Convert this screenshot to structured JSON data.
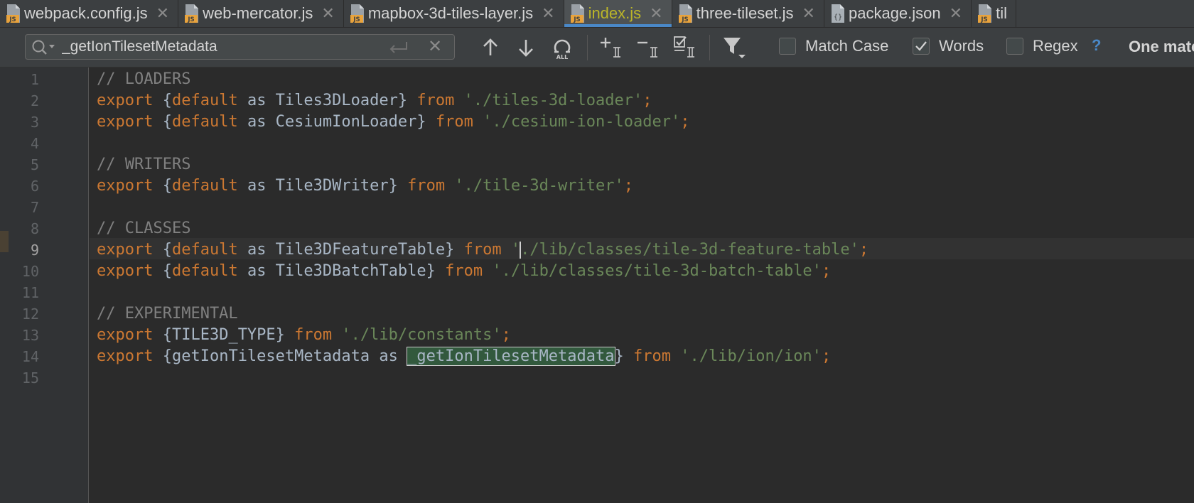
{
  "tabs": [
    {
      "label": "webpack.config.js",
      "icon": "js-file-icon",
      "active": false
    },
    {
      "label": "web-mercator.js",
      "icon": "js-file-icon",
      "active": false
    },
    {
      "label": "mapbox-3d-tiles-layer.js",
      "icon": "js-file-icon",
      "active": false
    },
    {
      "label": "index.js",
      "icon": "js-file-icon",
      "active": true
    },
    {
      "label": "three-tileset.js",
      "icon": "js-file-icon",
      "active": false
    },
    {
      "label": "package.json",
      "icon": "json-file-icon",
      "active": false
    },
    {
      "label": "til",
      "icon": "js-file-icon",
      "active": false
    }
  ],
  "tab_icon_text": "JS",
  "find": {
    "query": "_getIonTilesetMetadata",
    "match_case_label": "Match Case",
    "match_case_checked": false,
    "words_label": "Words",
    "words_checked": true,
    "regex_label": "Regex",
    "regex_checked": false,
    "help_label": "?",
    "result_text": "One match"
  },
  "editor": {
    "line_numbers": [
      "1",
      "2",
      "3",
      "4",
      "5",
      "6",
      "7",
      "8",
      "9",
      "10",
      "11",
      "12",
      "13",
      "14",
      "15"
    ],
    "current_line": "9",
    "lines": [
      [
        {
          "t": "// LOADERS",
          "c": "cm"
        }
      ],
      [
        {
          "t": "export",
          "c": "kw"
        },
        {
          "t": " {"
        },
        {
          "t": "default",
          "c": "kw"
        },
        {
          "t": " as Tiles3DLoader} "
        },
        {
          "t": "from",
          "c": "kw"
        },
        {
          "t": " "
        },
        {
          "t": "'./tiles-3d-loader'",
          "c": "str"
        },
        {
          "t": ";",
          "c": "kw"
        }
      ],
      [
        {
          "t": "export",
          "c": "kw"
        },
        {
          "t": " {"
        },
        {
          "t": "default",
          "c": "kw"
        },
        {
          "t": " as CesiumIonLoader} "
        },
        {
          "t": "from",
          "c": "kw"
        },
        {
          "t": " "
        },
        {
          "t": "'./cesium-ion-loader'",
          "c": "str"
        },
        {
          "t": ";",
          "c": "kw"
        }
      ],
      [],
      [
        {
          "t": "// WRITERS",
          "c": "cm"
        }
      ],
      [
        {
          "t": "export",
          "c": "kw"
        },
        {
          "t": " {"
        },
        {
          "t": "default",
          "c": "kw"
        },
        {
          "t": " as Tile3DWriter} "
        },
        {
          "t": "from",
          "c": "kw"
        },
        {
          "t": " "
        },
        {
          "t": "'./tile-3d-writer'",
          "c": "str"
        },
        {
          "t": ";",
          "c": "kw"
        }
      ],
      [],
      [
        {
          "t": "// CLASSES",
          "c": "cm"
        }
      ],
      [
        {
          "t": "export",
          "c": "kw"
        },
        {
          "t": " {"
        },
        {
          "t": "default",
          "c": "kw"
        },
        {
          "t": " as Tile3DFeatureTable} "
        },
        {
          "t": "from",
          "c": "kw"
        },
        {
          "t": " "
        },
        {
          "t": "'",
          "c": "str"
        },
        {
          "caret": true
        },
        {
          "t": "./lib/classes/tile-3d-feature-table'",
          "c": "str"
        },
        {
          "t": ";",
          "c": "kw"
        }
      ],
      [
        {
          "t": "export",
          "c": "kw"
        },
        {
          "t": " {"
        },
        {
          "t": "default",
          "c": "kw"
        },
        {
          "t": " as Tile3DBatchTable} "
        },
        {
          "t": "from",
          "c": "kw"
        },
        {
          "t": " "
        },
        {
          "t": "'./lib/classes/tile-3d-batch-table'",
          "c": "str"
        },
        {
          "t": ";",
          "c": "kw"
        }
      ],
      [],
      [
        {
          "t": "// EXPERIMENTAL",
          "c": "cm"
        }
      ],
      [
        {
          "t": "export",
          "c": "kw"
        },
        {
          "t": " {TILE3D_TYPE} "
        },
        {
          "t": "from",
          "c": "kw"
        },
        {
          "t": " "
        },
        {
          "t": "'./lib/constants'",
          "c": "str"
        },
        {
          "t": ";",
          "c": "kw"
        }
      ],
      [
        {
          "t": "export",
          "c": "kw"
        },
        {
          "t": " {getIonTilesetMetadata as "
        },
        {
          "t": "_getIonTilesetMetadata",
          "c": "match"
        },
        {
          "t": "} "
        },
        {
          "t": "from",
          "c": "kw"
        },
        {
          "t": " "
        },
        {
          "t": "'./lib/ion/ion'",
          "c": "str"
        },
        {
          "t": ";",
          "c": "kw"
        }
      ],
      []
    ]
  }
}
